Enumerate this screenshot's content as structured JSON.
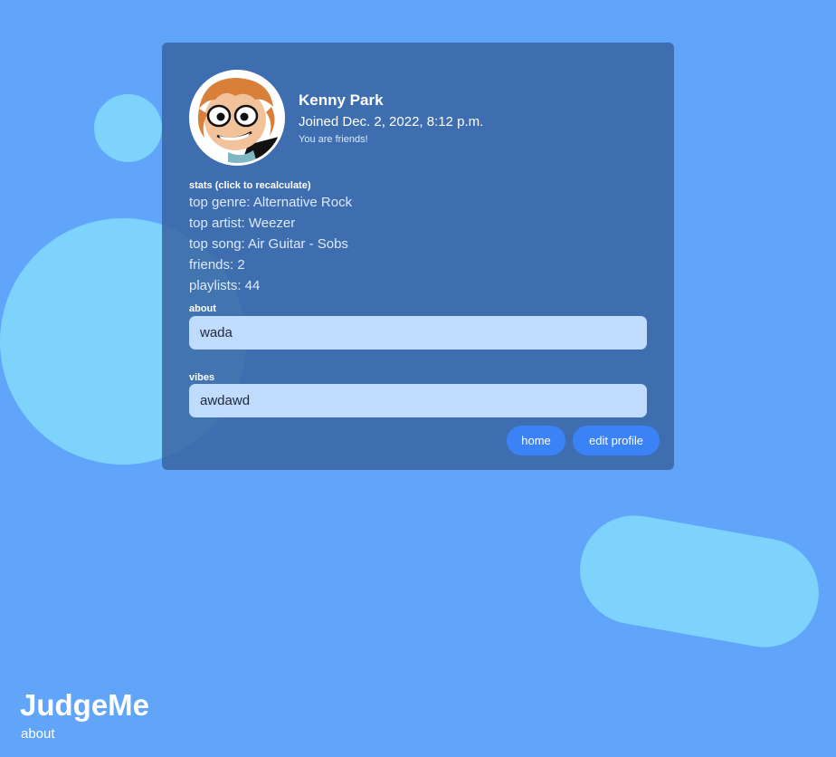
{
  "colors": {
    "background": "#61a5fa",
    "card": "#3a67a5",
    "blob": "#7dd3fc",
    "input_bg": "#bfdbfe",
    "button": "#3b82f6"
  },
  "profile": {
    "avatar_icon": "cartoon-avatar-icon",
    "name": "Kenny Park",
    "joined": "Joined Dec. 2, 2022, 8:12 p.m.",
    "friend_status": "You are friends!"
  },
  "stats": {
    "heading": "stats (click to recalculate)",
    "items": [
      "top genre: Alternative Rock",
      "top artist: Weezer",
      "top song: Air Guitar - Sobs",
      "friends: 2",
      "playlists: 44"
    ]
  },
  "about": {
    "label": "about",
    "value": "wada"
  },
  "vibes": {
    "label": "vibes",
    "value": "awdawd"
  },
  "buttons": {
    "home": "home",
    "edit_profile": "edit profile"
  },
  "footer": {
    "brand": "JudgeMe",
    "about_link": "about"
  }
}
